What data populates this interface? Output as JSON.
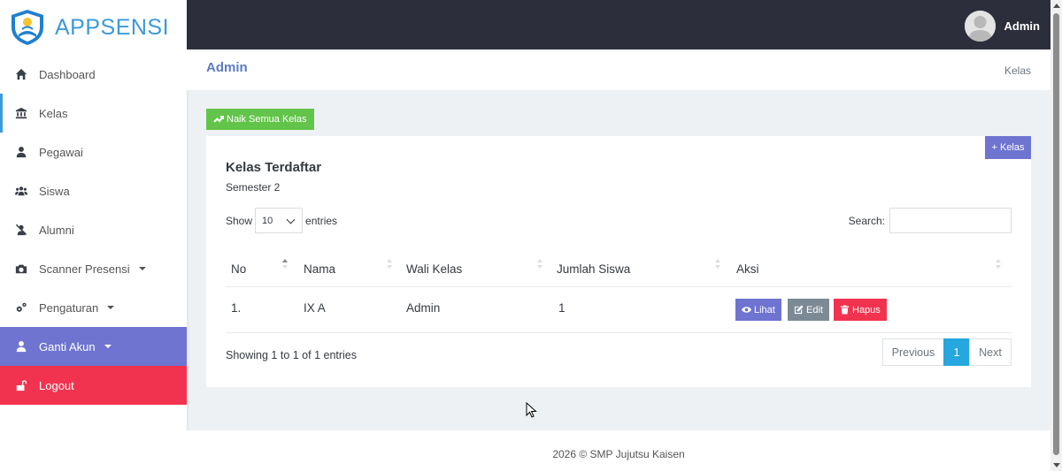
{
  "brand": {
    "name": "APPSENSI"
  },
  "sidebar": {
    "items": [
      {
        "label": "Dashboard",
        "icon": "home-icon"
      },
      {
        "label": "Kelas",
        "icon": "bank-icon"
      },
      {
        "label": "Pegawai",
        "icon": "user-tie-icon"
      },
      {
        "label": "Siswa",
        "icon": "users-icon"
      },
      {
        "label": "Alumni",
        "icon": "user-slash-icon"
      },
      {
        "label": "Scanner Presensi",
        "icon": "camera-icon"
      },
      {
        "label": "Pengaturan",
        "icon": "cogs-icon"
      },
      {
        "label": "Ganti Akun",
        "icon": "user-icon"
      },
      {
        "label": "Logout",
        "icon": "unlock-icon"
      }
    ]
  },
  "topbar": {
    "user_name": "Admin"
  },
  "header": {
    "title": "Admin",
    "breadcrumb": "Kelas"
  },
  "actions": {
    "naik_label": "Naik Semua Kelas",
    "add_label": "+ Kelas"
  },
  "card": {
    "title": "Kelas Terdaftar",
    "subtitle": "Semester 2"
  },
  "table_controls": {
    "show_label": "Show",
    "entries_label": "entries",
    "length_value": "10",
    "search_label": "Search:"
  },
  "table": {
    "columns": [
      "No",
      "Nama",
      "Wali Kelas",
      "Jumlah Siswa",
      "Aksi"
    ],
    "rows": [
      {
        "no": "1.",
        "nama": "IX A",
        "wali": "Admin",
        "jumlah": "1"
      }
    ],
    "row_actions": {
      "view": "Lihat",
      "edit": "Edit",
      "delete": "Hapus"
    }
  },
  "pagination": {
    "info": "Showing 1 to 1 of 1 entries",
    "previous": "Previous",
    "current": "1",
    "next": "Next"
  },
  "footer": {
    "text": "2026 © SMP Jujutsu Kaisen"
  },
  "colors": {
    "sidebar_accent": "#3b9ad9",
    "ganti_bg": "#6f74d1",
    "logout_bg": "#f2334f",
    "topbar_bg": "#2c2f3b",
    "success": "#62c449",
    "pager_active": "#26a7df"
  }
}
